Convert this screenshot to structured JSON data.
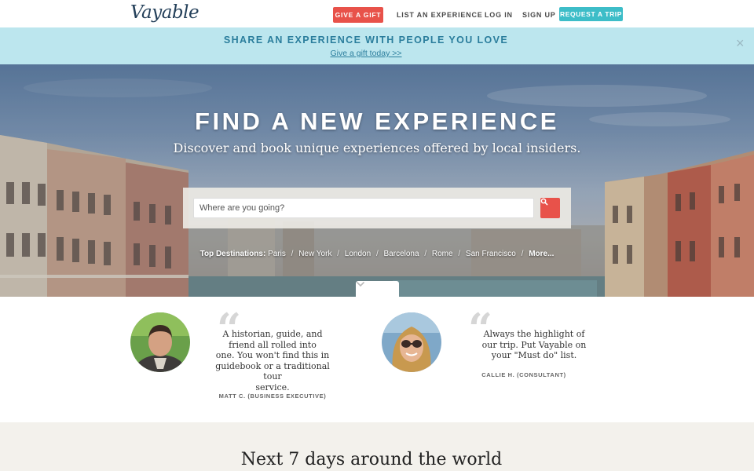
{
  "header": {
    "logo_text": "Vayable",
    "gift_button": "GIVE A GIFT",
    "list_experience": "LIST AN EXPERIENCE",
    "log_in": "LOG IN",
    "sign_up": "SIGN UP",
    "request_trip": "REQUEST A TRIP"
  },
  "promo": {
    "title": "SHARE AN EXPERIENCE WITH PEOPLE YOU LOVE",
    "link": "Give a gift today >>",
    "close_icon": "close-icon"
  },
  "hero": {
    "title": "FIND A NEW EXPERIENCE",
    "subtitle": "Discover and book unique experiences offered by local insiders.",
    "search_placeholder": "Where are you going?",
    "search_icon": "search-icon",
    "destinations_label": "Top Destinations:",
    "destinations": [
      "Paris",
      "New York",
      "London",
      "Barcelona",
      "Rome",
      "San Francisco"
    ],
    "more": "More...",
    "scroll_icon": "chevron-down-icon"
  },
  "testimonials": [
    {
      "quote_lines": [
        "A historian, guide, and",
        "friend all rolled into",
        "one. You won't find this in",
        "guidebook or a traditional tour",
        "service."
      ],
      "author": "MATT C. (BUSINESS EXECUTIVE)"
    },
    {
      "quote_lines": [
        "Always the highlight of",
        "our trip. Put Vayable on",
        "your \"Must do\" list."
      ],
      "author": "CALLIE H. (CONSULTANT)"
    }
  ],
  "next_section": {
    "title": "Next 7 days around the world"
  },
  "colors": {
    "accent_red": "#e8524a",
    "accent_teal": "#3dbdc8",
    "promo_bg": "#bce6ee",
    "promo_text": "#2a7d9c"
  }
}
